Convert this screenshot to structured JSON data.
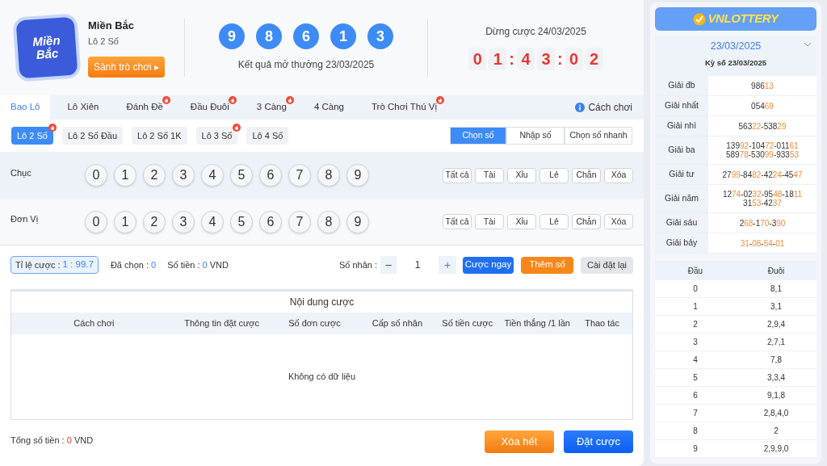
{
  "header": {
    "logo_lines": [
      "Miền",
      "Bắc"
    ],
    "region": "Miền Bắc",
    "game": "Lô 2 Số",
    "lobby_button": "Sảnh trò chơi ▸",
    "result_balls": [
      "9",
      "8",
      "6",
      "1",
      "3"
    ],
    "result_caption": "Kết quả mở thưởng 23/03/2025",
    "deadline": "Dừng cược 24/03/2025",
    "countdown": [
      "0",
      "1",
      ":",
      "4",
      "3",
      ":",
      "0",
      "2"
    ]
  },
  "tabs": [
    {
      "label": "Bao Lô",
      "selected": true,
      "hot": false
    },
    {
      "label": "Lô Xiên",
      "selected": false,
      "hot": false
    },
    {
      "label": "Đánh Đề",
      "selected": false,
      "hot": true
    },
    {
      "label": "Đầu Đuôi",
      "selected": false,
      "hot": true
    },
    {
      "label": "3 Càng",
      "selected": false,
      "hot": true
    },
    {
      "label": "4 Càng",
      "selected": false,
      "hot": false
    },
    {
      "label": "Trò Chơi Thú Vị",
      "selected": false,
      "hot": true
    }
  ],
  "help_link": "Cách chơi",
  "subtabs": [
    {
      "label": "Lô 2 Số",
      "selected": true,
      "hot": true
    },
    {
      "label": "Lô 2 Số Đầu",
      "selected": false,
      "hot": false
    },
    {
      "label": "Lô 2 Số 1K",
      "selected": false,
      "hot": false
    },
    {
      "label": "Lô 3 Số",
      "selected": false,
      "hot": true
    },
    {
      "label": "Lô 4 Số",
      "selected": false,
      "hot": false
    }
  ],
  "modes": [
    {
      "label": "Chọn số",
      "selected": true
    },
    {
      "label": "Nhập số",
      "selected": false
    },
    {
      "label": "Chọn số nhanh",
      "selected": false
    }
  ],
  "pick_rows": [
    {
      "label": "Chục",
      "numbers": [
        "0",
        "1",
        "2",
        "3",
        "4",
        "5",
        "6",
        "7",
        "8",
        "9"
      ],
      "actions": [
        "Tất cả",
        "Tài",
        "Xỉu",
        "Lẻ",
        "Chẵn",
        "Xóa"
      ]
    },
    {
      "label": "Đơn Vị",
      "numbers": [
        "0",
        "1",
        "2",
        "3",
        "4",
        "5",
        "6",
        "7",
        "8",
        "9"
      ],
      "actions": [
        "Tất cả",
        "Tài",
        "Xỉu",
        "Lẻ",
        "Chẵn",
        "Xóa"
      ]
    }
  ],
  "bet_bar": {
    "odds_label": "Tỉ lệ cược :",
    "odds_value": "1 : 99.7",
    "picked_label": "Đã chọn :",
    "picked_value": "0",
    "amount_label": "Số tiền :",
    "amount_value": "0",
    "amount_unit": "VND",
    "multiplier_label": "Số nhân :",
    "minus": "–",
    "multiplier": "1",
    "plus": "+",
    "bet_now": "Cược ngay",
    "add_number": "Thêm số",
    "reset": "Cài đặt lại"
  },
  "bet_table": {
    "title": "Nội dung cược",
    "columns": [
      "Cách chơi",
      "Thông tin đặt cược",
      "Số đơn cược",
      "Cấp số nhân",
      "Số tiền cược",
      "Tiền thắng /1 lần",
      "Thao tác"
    ],
    "empty": "Không có dữ liệu"
  },
  "total": {
    "label": "Tổng số tiền :",
    "value": "0",
    "unit": "VND"
  },
  "actions": {
    "clear": "Xóa hết",
    "place": "Đặt cược"
  },
  "sidebar": {
    "logo": "VNLOTTERY",
    "date": "23/03/2025",
    "draw_title": "Kỳ số 23/03/2025",
    "prizes": [
      {
        "name": "Giải đb",
        "lines": [
          "986**13**"
        ]
      },
      {
        "name": "Giải nhất",
        "lines": [
          "054**69**"
        ]
      },
      {
        "name": "Giải nhì",
        "lines": [
          "563**22**-538**29**"
        ]
      },
      {
        "name": "Giải ba",
        "lines": [
          "139**92**-104**72**-011**61**",
          "589**78**-530**99**-933**53**"
        ]
      },
      {
        "name": "Giải tư",
        "lines": [
          "27**99**-84**82**-42**24**-45**47**"
        ]
      },
      {
        "name": "Giải năm",
        "lines": [
          "12**74**-02**32**-95**48**-18**11**",
          "31**53**-42**37**"
        ]
      },
      {
        "name": "Giải sáu",
        "lines": [
          "2**68**-1**70**-3**90**"
        ]
      },
      {
        "name": "Giải bảy",
        "lines": [
          "**31**-**08**-**54**-**01**"
        ]
      }
    ],
    "head_tail": {
      "columns": [
        "Đầu",
        "Đuôi"
      ],
      "rows": [
        [
          "0",
          "8,1"
        ],
        [
          "1",
          "3,1"
        ],
        [
          "2",
          "2,9,4"
        ],
        [
          "3",
          "2,7,1"
        ],
        [
          "4",
          "7,8"
        ],
        [
          "5",
          "3,3,4"
        ],
        [
          "6",
          "9,1,8"
        ],
        [
          "7",
          "2,8,4,0"
        ],
        [
          "8",
          "2"
        ],
        [
          "9",
          "2,9,9,0"
        ]
      ]
    }
  }
}
